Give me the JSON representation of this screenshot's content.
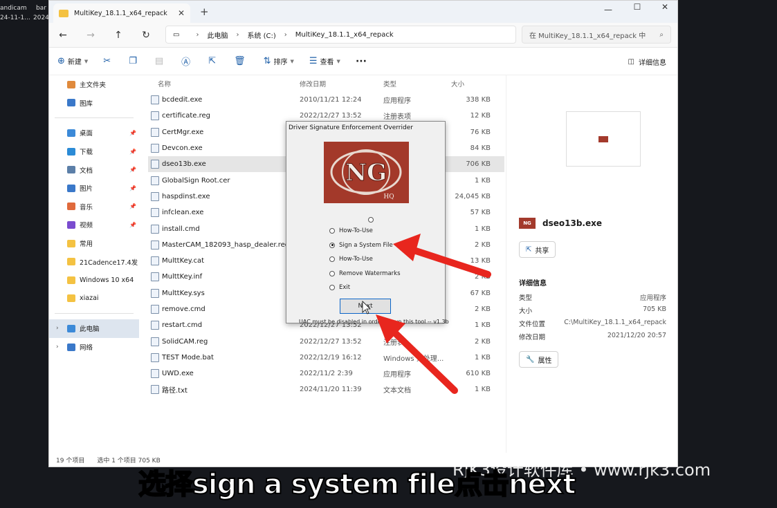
{
  "desktop": {
    "item1": "andicam",
    "item1_sub": "24-11-1...",
    "item2": "bar",
    "item2_sub": "2024"
  },
  "window": {
    "tab_title": "MultiKey_18.1.1_x64_repack",
    "close_tab": "✕",
    "new_tab": "+",
    "minimize": "—",
    "maximize": "☐",
    "close": "✕"
  },
  "nav": {
    "back": "←",
    "forward": "→",
    "up": "↑",
    "refresh": "↻",
    "breadcrumb": [
      "此电脑",
      "系统 (C:)",
      "MultiKey_18.1.1_x64_repack"
    ],
    "search_placeholder": "在 MultiKey_18.1.1_x64_repack 中"
  },
  "toolbar": {
    "new_label": "新建",
    "sort_label": "排序",
    "view_label": "查看",
    "more_label": "···",
    "details_label": "详细信息"
  },
  "sidebar": {
    "quick": [
      {
        "label": "主文件夹",
        "color": "#e08a3c"
      },
      {
        "label": "图库",
        "color": "#3a78c9"
      }
    ],
    "pinned": [
      {
        "label": "桌面",
        "color": "#3c8ad8",
        "pin": "📌"
      },
      {
        "label": "下载",
        "color": "#2b8bd6",
        "pin": "📌"
      },
      {
        "label": "文档",
        "color": "#5c7fa8",
        "pin": "📌"
      },
      {
        "label": "图片",
        "color": "#3a78c9",
        "pin": "📌"
      },
      {
        "label": "音乐",
        "color": "#e06a3c",
        "pin": "📌"
      },
      {
        "label": "视频",
        "color": "#7a4ccf",
        "pin": "📌"
      },
      {
        "label": "常用",
        "color": "#f4c242",
        "pin": ""
      },
      {
        "label": "21Cadence17.4发",
        "color": "#f4c242",
        "pin": ""
      },
      {
        "label": "Windows 10 x64",
        "color": "#f4c242",
        "pin": ""
      },
      {
        "label": "xiazai",
        "color": "#f4c242",
        "pin": ""
      }
    ],
    "thispc": "此电脑",
    "network": "网络",
    "expand": "›"
  },
  "filelist": {
    "headers": {
      "name": "名称",
      "date": "修改日期",
      "type": "类型",
      "size": "大小"
    },
    "rows": [
      {
        "name": "bcdedit.exe",
        "date": "2010/11/21 12:24",
        "type": "应用程序",
        "size": "338 KB"
      },
      {
        "name": "certificate.reg",
        "date": "2022/12/27 13:52",
        "type": "注册表项",
        "size": "12 KB"
      },
      {
        "name": "CertMgr.exe",
        "date": "",
        "type": "",
        "size": "76 KB"
      },
      {
        "name": "Devcon.exe",
        "date": "",
        "type": "",
        "size": "84 KB"
      },
      {
        "name": "dseo13b.exe",
        "date": "",
        "type": "",
        "size": "706 KB"
      },
      {
        "name": "GlobalSign Root.cer",
        "date": "",
        "type": "",
        "size": "1 KB"
      },
      {
        "name": "haspdinst.exe",
        "date": "",
        "type": "",
        "size": "24,045 KB"
      },
      {
        "name": "infclean.exe",
        "date": "",
        "type": "",
        "size": "57 KB"
      },
      {
        "name": "install.cmd",
        "date": "",
        "type": "",
        "size": "1 KB"
      },
      {
        "name": "MasterCAM_182093_hasp_dealer.reg",
        "date": "",
        "type": "",
        "size": "2 KB"
      },
      {
        "name": "MulttKey.cat",
        "date": "",
        "type": "",
        "size": "13 KB"
      },
      {
        "name": "MulttKey.inf",
        "date": "",
        "type": "",
        "size": "2 KB"
      },
      {
        "name": "MulttKey.sys",
        "date": "",
        "type": "",
        "size": "67 KB"
      },
      {
        "name": "remove.cmd",
        "date": "",
        "type": "",
        "size": "2 KB"
      },
      {
        "name": "restart.cmd",
        "date": "2022/12/27 13:52",
        "type": "",
        "size": "1 KB"
      },
      {
        "name": "SolidCAM.reg",
        "date": "2022/12/27 13:52",
        "type": "注册表",
        "size": "2 KB"
      },
      {
        "name": "TEST Mode.bat",
        "date": "2022/12/19 16:12",
        "type": "Windows 批处理...",
        "size": "1 KB"
      },
      {
        "name": "UWD.exe",
        "date": "2022/11/2 2:39",
        "type": "应用程序",
        "size": "610 KB"
      },
      {
        "name": "路径.txt",
        "date": "2024/11/20 11:39",
        "type": "文本文档",
        "size": "1 KB"
      }
    ]
  },
  "details": {
    "filename": "dseo13b.exe",
    "logo_text": "NG",
    "share_label": "共享",
    "section_title": "详细信息",
    "props": [
      {
        "k": "类型",
        "v": "应用程序"
      },
      {
        "k": "大小",
        "v": "705 KB"
      },
      {
        "k": "文件位置",
        "v": "C:\\MultiKey_18.1.1_x64_repack"
      },
      {
        "k": "修改日期",
        "v": "2021/12/20 20:57"
      }
    ],
    "properties_label": "属性"
  },
  "status": {
    "count": "19 个项目",
    "selected": "选中 1 个项目  705 KB"
  },
  "dialog": {
    "title": "Driver Signature Enforcement Overrider",
    "logo_text": "NG",
    "logo_sub": "HQ",
    "options": [
      {
        "label": "How-To-Use",
        "checked": false
      },
      {
        "label": "Sign a System File",
        "checked": true
      },
      {
        "label": "How-To-Use",
        "checked": false
      },
      {
        "label": "Remove Watermarks",
        "checked": false
      },
      {
        "label": "Exit",
        "checked": false
      }
    ],
    "next_label": "Next",
    "note": "UAC must be disabled in order to run this tool -- v1.3b"
  },
  "caption": "选择sign a system file点击next",
  "watermark": "RJK3设计软件库 • www.rjk3.com"
}
